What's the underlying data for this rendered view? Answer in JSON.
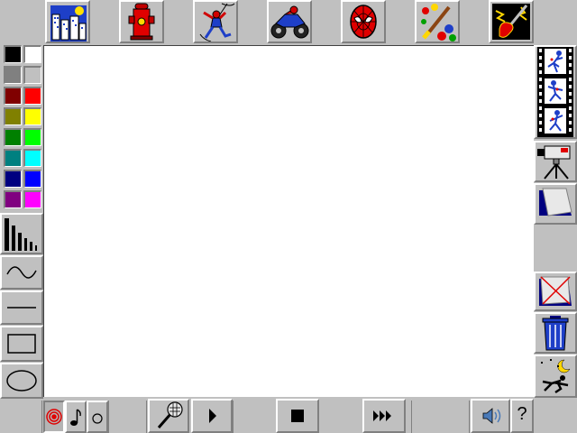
{
  "stamp_categories": [
    {
      "name": "city-icon"
    },
    {
      "name": "fire-hydrant-icon"
    },
    {
      "name": "spider-man-swinging-icon"
    },
    {
      "name": "motorcycle-icon"
    },
    {
      "name": "spider-man-mask-icon"
    },
    {
      "name": "paint-brush-icon"
    },
    {
      "name": "electric-guitar-icon"
    }
  ],
  "palette": [
    [
      "#000000",
      "#ffffff"
    ],
    [
      "#808080",
      "#c0c0c0"
    ],
    [
      "#800000",
      "#ff0000"
    ],
    [
      "#808000",
      "#ffff00"
    ],
    [
      "#008000",
      "#00ff00"
    ],
    [
      "#008080",
      "#00ffff"
    ],
    [
      "#000080",
      "#0000ff"
    ],
    [
      "#800080",
      "#ff00ff"
    ]
  ],
  "help_label": "?"
}
